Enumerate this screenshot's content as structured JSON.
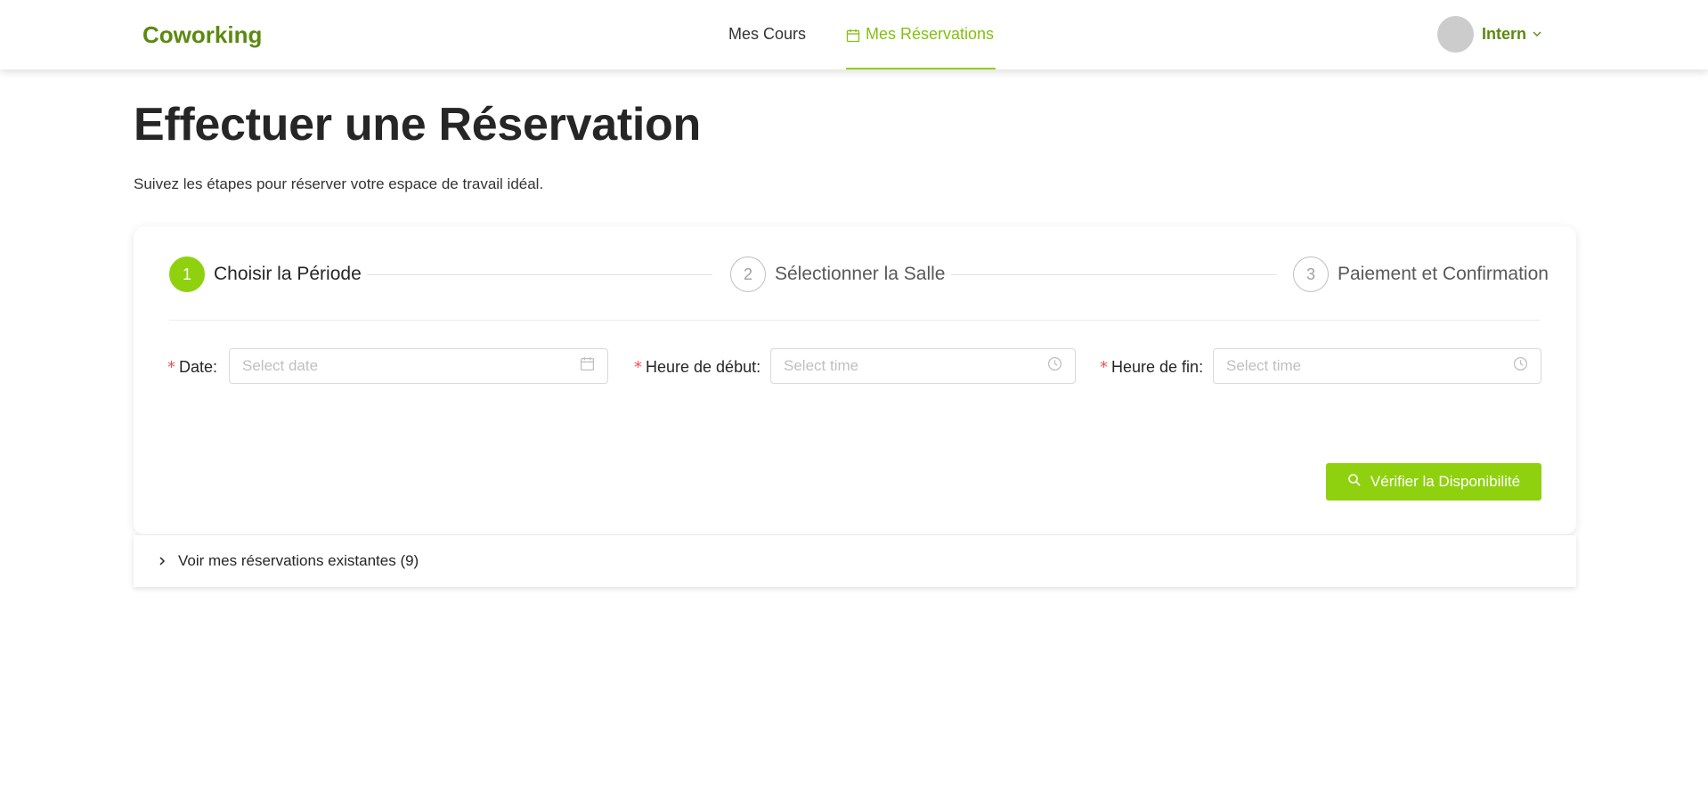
{
  "header": {
    "brand": "Coworking",
    "nav": {
      "courses": "Mes Cours",
      "reservations": "Mes Réservations"
    },
    "user": "Intern"
  },
  "page": {
    "title": "Effectuer une Réservation",
    "subtitle": "Suivez les étapes pour réserver votre espace de travail idéal."
  },
  "steps": [
    {
      "number": "1",
      "label": "Choisir la Période",
      "status": "active"
    },
    {
      "number": "2",
      "label": "Sélectionner la Salle",
      "status": "waiting"
    },
    {
      "number": "3",
      "label": "Paiement et Confirmation",
      "status": "waiting"
    }
  ],
  "form": {
    "date": {
      "label": "Date",
      "placeholder": "Select date",
      "value": ""
    },
    "start": {
      "label": "Heure de début",
      "placeholder": "Select time",
      "value": ""
    },
    "end": {
      "label": "Heure de fin",
      "placeholder": "Select time",
      "value": ""
    },
    "required_mark": "*",
    "colon": ":",
    "submit_label": "Vérifier la Disponibilité"
  },
  "existing": {
    "label": "Voir mes réservations existantes (9)"
  },
  "colors": {
    "accent": "#8fd10f",
    "brand": "#5b8a10",
    "required": "#ff4d4f"
  }
}
